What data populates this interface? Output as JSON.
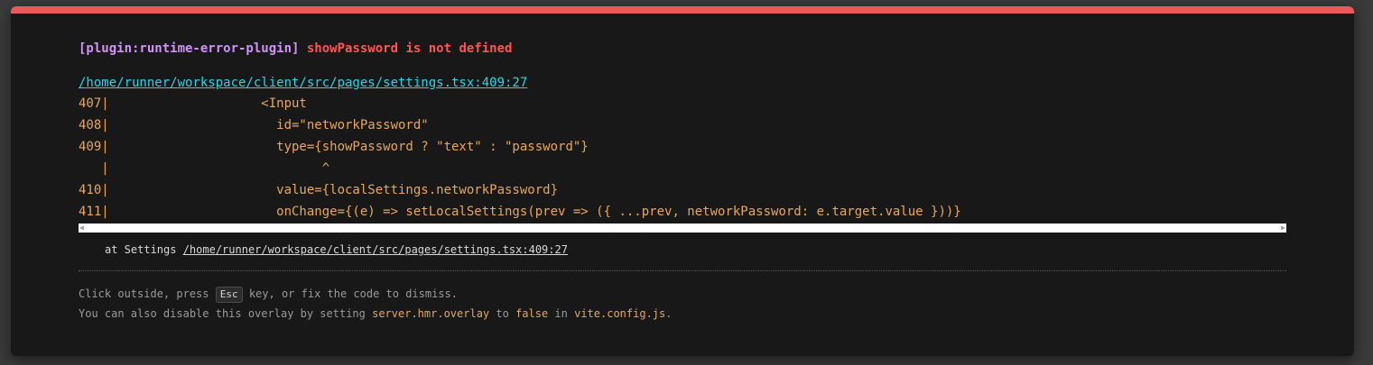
{
  "colors": {
    "top_bar": "#e95a5a",
    "plugin_tag": "#cf94f5",
    "error_text": "#ff5555",
    "file_link": "#2dd4e8",
    "code_text": "#e8a75a",
    "background": "#181818"
  },
  "error": {
    "plugin": "[plugin:runtime-error-plugin]",
    "message": "showPassword is not defined"
  },
  "file": "/home/runner/workspace/client/src/pages/settings.tsx:409:27",
  "frame": {
    "lines": [
      "407|                    <Input",
      "408|                      id=\"networkPassword\"",
      "409|                      type={showPassword ? \"text\" : \"password\"}",
      "   |                            ^",
      "410|                      value={localSettings.networkPassword}",
      "411|                      onChange={(e) => setLocalSettings(prev => ({ ...prev, networkPassword: e.target.value }))}"
    ]
  },
  "scrollbar": {
    "left_arrow": "◀",
    "right_arrow": "▶"
  },
  "stack": {
    "prefix": "at Settings ",
    "link": "/home/runner/workspace/client/src/pages/settings.tsx:409:27"
  },
  "tip": {
    "line1_before": "Click outside, press ",
    "key": "Esc",
    "line1_after": " key, or fix the code to dismiss.",
    "line2_before": "You can also disable this overlay by setting ",
    "config_key": "server.hmr.overlay",
    "line2_mid": " to ",
    "config_value": "false",
    "line2_in": " in ",
    "config_file": "vite.config.js",
    "line2_end": "."
  }
}
